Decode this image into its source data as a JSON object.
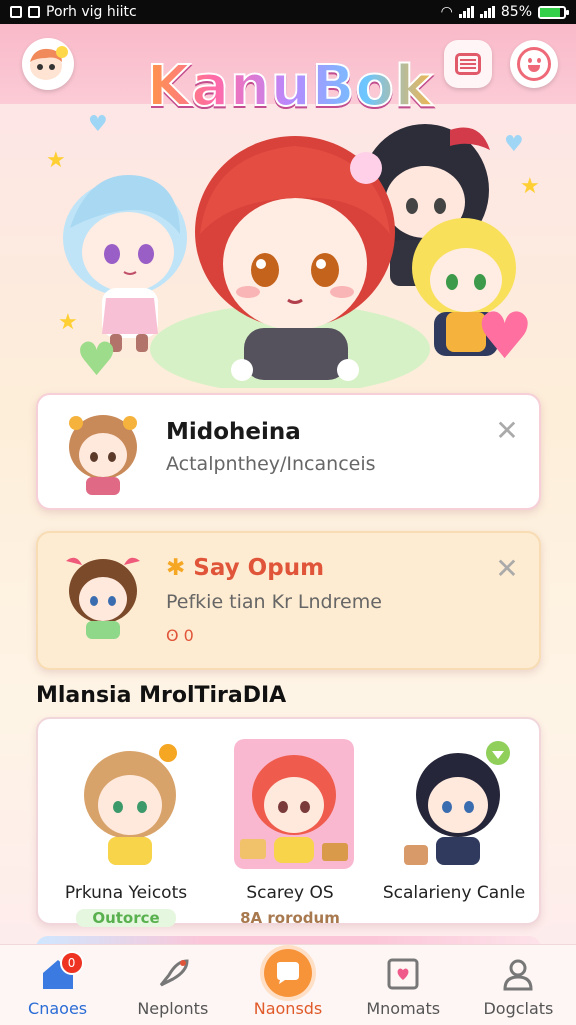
{
  "status_bar": {
    "left_text": "Porh vig hiitc",
    "battery": "85%",
    "battery_level": 0.85
  },
  "header": {
    "app_title": "KanuBok",
    "menu_icon": "list-menu-icon",
    "profile_icon": "smiley-face-icon"
  },
  "cards": [
    {
      "title": "Midoheina",
      "subtitle": "Actalpnthey/Incanceis",
      "close_icon": "close-x-icon"
    },
    {
      "title": "Say Opum",
      "title_icon": "star-sparkle-icon",
      "subtitle": "Pefkie tian Kr Lndreme",
      "badge": "ʘ 0",
      "close_icon": "close-x-icon"
    }
  ],
  "section": {
    "title": "Mlansia MrolTiraDIA",
    "items": [
      {
        "name": "Prkuna Yeicots",
        "tag": "Outorce",
        "tag_color": "#6fcf6a"
      },
      {
        "name": "Scarey OS",
        "tag": "8A rorodum",
        "tag_color": "#b37a50"
      },
      {
        "name": "Scalarieny Canle",
        "tag": ""
      }
    ]
  },
  "bottom_nav": [
    {
      "label": "Cnaoes",
      "icon": "home-icon",
      "badge": "0"
    },
    {
      "label": "Neplonts",
      "icon": "rocket-icon"
    },
    {
      "label": "Naonsds",
      "icon": "chat-bubble-icon"
    },
    {
      "label": "Mnomats",
      "icon": "picture-frame-icon"
    },
    {
      "label": "Dogclats",
      "icon": "user-icon"
    }
  ]
}
